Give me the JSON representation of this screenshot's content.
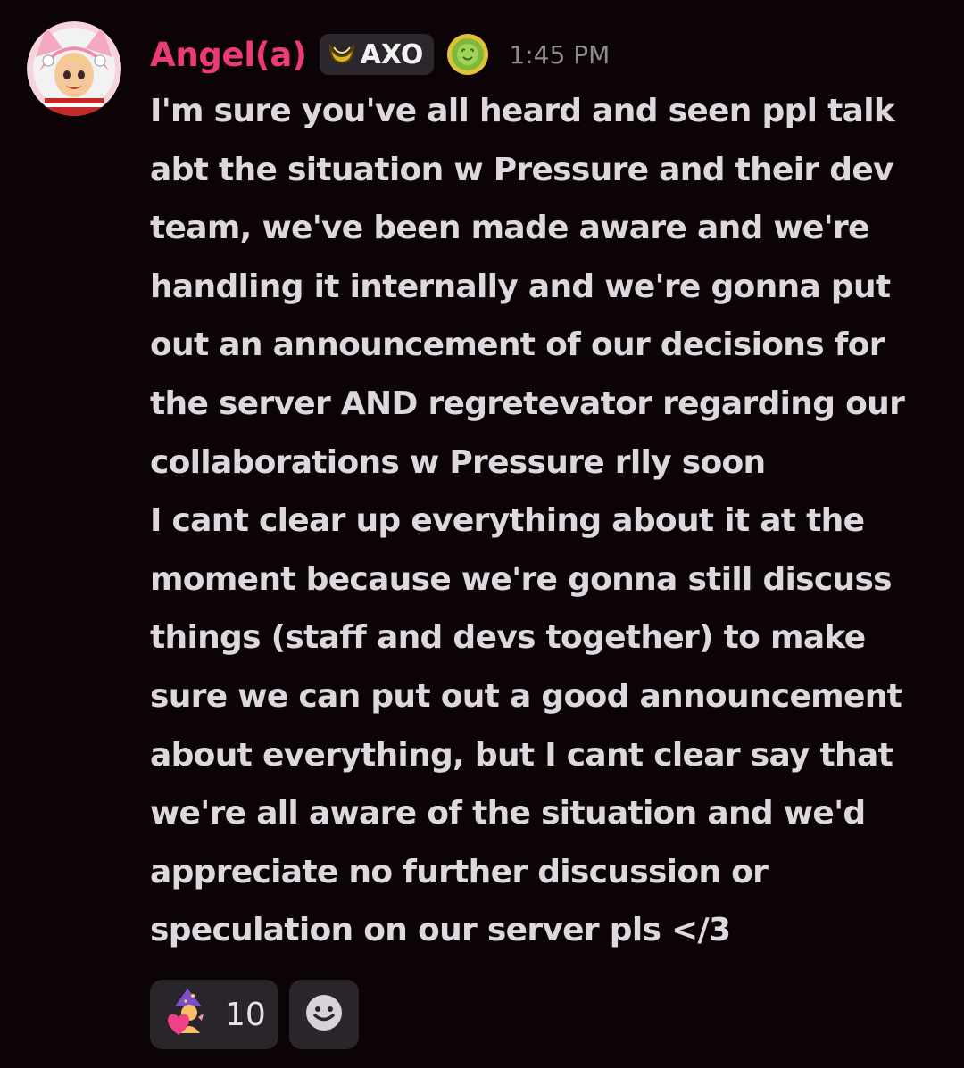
{
  "message": {
    "author": "Angel(a)",
    "tag": {
      "label": "AXO",
      "icon": "crescent-moon-icon"
    },
    "role_icon": "green-badge-icon",
    "timestamp": "1:45 PM",
    "lines": [
      "I'm sure you've all heard and seen ppl talk",
      "abt the situation w Pressure and their dev",
      "team, we've been made aware and we're",
      "handling it internally and we're gonna put",
      "out an announcement of our decisions for",
      "the server AND regretevator regarding our",
      "collaborations w Pressure rlly soon",
      "I cant clear up everything about it at the",
      "moment because we're gonna still discuss",
      "things (staff and devs together) to make",
      "sure we can put out a good announcement",
      "about everything, but I cant clear say that",
      "we're all aware of the situation and we'd",
      "appreciate no further discussion or",
      "speculation on our server pls </3"
    ]
  },
  "reactions": [
    {
      "emoji": "wizard-heart-emoji",
      "count": "10"
    }
  ],
  "add_reaction_icon": "smiley-icon",
  "colors": {
    "background": "#0c0307",
    "username": "#ec3a78",
    "text": "#dcd8dd",
    "timestamp": "#8d8a90",
    "chip": "#29252a"
  }
}
